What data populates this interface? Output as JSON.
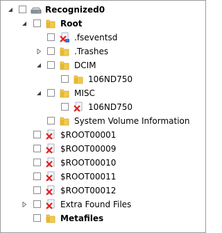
{
  "tree": {
    "rows": [
      {
        "label": "Recognized0",
        "icon": "drive-icon",
        "bold": true,
        "expander": "expanded"
      },
      {
        "label": "Root",
        "icon": "folder-icon",
        "bold": true,
        "expander": "expanded"
      },
      {
        "label": ".fseventsd",
        "icon": "deleted-file-icon",
        "bold": false,
        "expander": "none"
      },
      {
        "label": ".Trashes",
        "icon": "folder-icon",
        "bold": false,
        "expander": "collapsed"
      },
      {
        "label": "DCIM",
        "icon": "folder-icon",
        "bold": false,
        "expander": "expanded"
      },
      {
        "label": "106ND750",
        "icon": "folder-icon",
        "bold": false,
        "expander": "none"
      },
      {
        "label": "MISC",
        "icon": "folder-icon",
        "bold": false,
        "expander": "expanded"
      },
      {
        "label": "106ND750",
        "icon": "deleted-file-icon",
        "bold": false,
        "expander": "none"
      },
      {
        "label": "System Volume Information",
        "icon": "folder-icon",
        "bold": false,
        "expander": "none"
      },
      {
        "label": "$ROOT00001",
        "icon": "deleted-file-icon",
        "bold": false,
        "expander": "none"
      },
      {
        "label": "$ROOT00009",
        "icon": "deleted-file-icon",
        "bold": false,
        "expander": "none"
      },
      {
        "label": "$ROOT00010",
        "icon": "deleted-file-icon",
        "bold": false,
        "expander": "none"
      },
      {
        "label": "$ROOT00011",
        "icon": "deleted-file-icon",
        "bold": false,
        "expander": "none"
      },
      {
        "label": "$ROOT00012",
        "icon": "deleted-file-icon",
        "bold": false,
        "expander": "none"
      },
      {
        "label": "Extra Found Files",
        "icon": "deleted-file-icon",
        "bold": false,
        "expander": "collapsed"
      },
      {
        "label": "Metafiles",
        "icon": "folder-icon",
        "bold": true,
        "expander": "none"
      }
    ]
  },
  "colors": {
    "folder": "#f2c94c",
    "folder_dark": "#d9a520",
    "deleted_mark": "#e02020",
    "expander": "#404040"
  }
}
